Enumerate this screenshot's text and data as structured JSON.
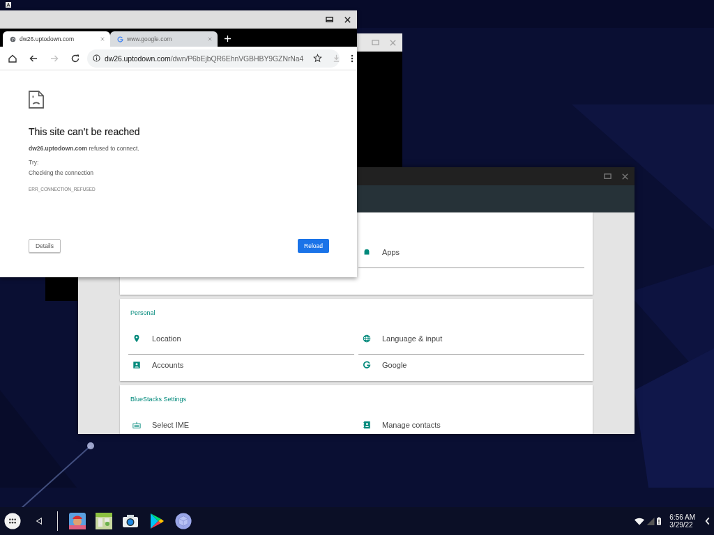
{
  "browser": {
    "tabs": [
      {
        "title": "dw26.uptodown.com",
        "selected": true
      },
      {
        "title": "www.google.com",
        "selected": false
      }
    ],
    "forward_disabled": true,
    "address": {
      "host": "dw26.uptodown.com",
      "path": "/dwn/P6bEjbQR6EhnVGBHBY9GZNrNa4"
    },
    "error": {
      "title": "This site can’t be reached",
      "message": "**dw26.uptodown.com** refused to connect.",
      "try_label": "Try:",
      "suggestion": "Checking the connection",
      "code": "ERR_CONNECTION_REFUSED"
    },
    "buttons": [
      {
        "label": "Details",
        "kind": "secondary"
      },
      {
        "label": "Reload",
        "kind": "primary"
      }
    ]
  },
  "settings": {
    "sections": [
      {
        "items": [
          {
            "label": "Apps"
          }
        ]
      },
      {
        "title": "Personal",
        "items": [
          {
            "label": "Location"
          },
          {
            "label": "Language & input"
          },
          {
            "label": "Accounts"
          },
          {
            "label": "Google"
          }
        ]
      },
      {
        "title": "BlueStacks Settings",
        "items": [
          {
            "label": "Select IME"
          },
          {
            "label": "Manage contacts"
          }
        ]
      }
    ]
  },
  "taskbar": {
    "time": "6:56 AM",
    "date": "3/29/22"
  }
}
